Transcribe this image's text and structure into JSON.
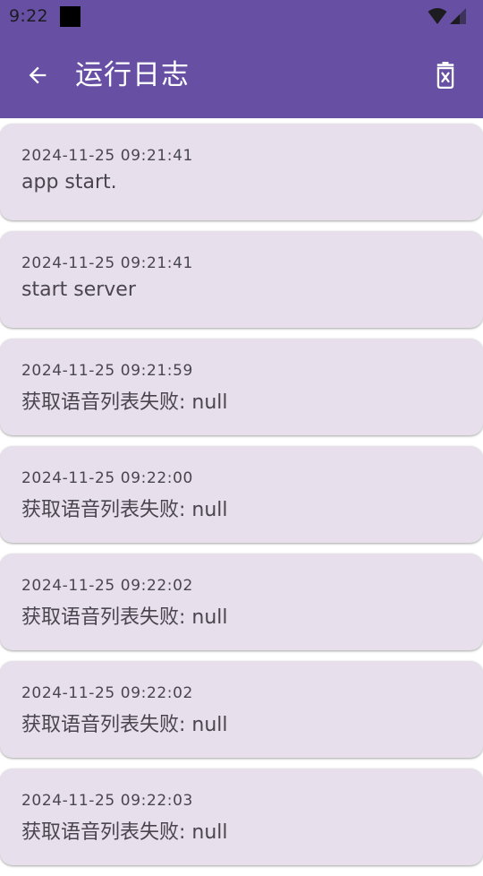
{
  "status_bar": {
    "time": "9:22"
  },
  "app_bar": {
    "title": "运行日志"
  },
  "logs": [
    {
      "time": "2024-11-25 09:21:41",
      "message": "app start."
    },
    {
      "time": "2024-11-25 09:21:41",
      "message": "start server"
    },
    {
      "time": "2024-11-25 09:21:59",
      "message": "获取语音列表失败: null"
    },
    {
      "time": "2024-11-25 09:22:00",
      "message": "获取语音列表失败: null"
    },
    {
      "time": "2024-11-25 09:22:02",
      "message": "获取语音列表失败: null"
    },
    {
      "time": "2024-11-25 09:22:02",
      "message": "获取语音列表失败: null"
    },
    {
      "time": "2024-11-25 09:22:03",
      "message": "获取语音列表失败: null"
    }
  ],
  "colors": {
    "primary": "#6750a4",
    "card": "#e7e0ec",
    "text": "#49454f"
  }
}
